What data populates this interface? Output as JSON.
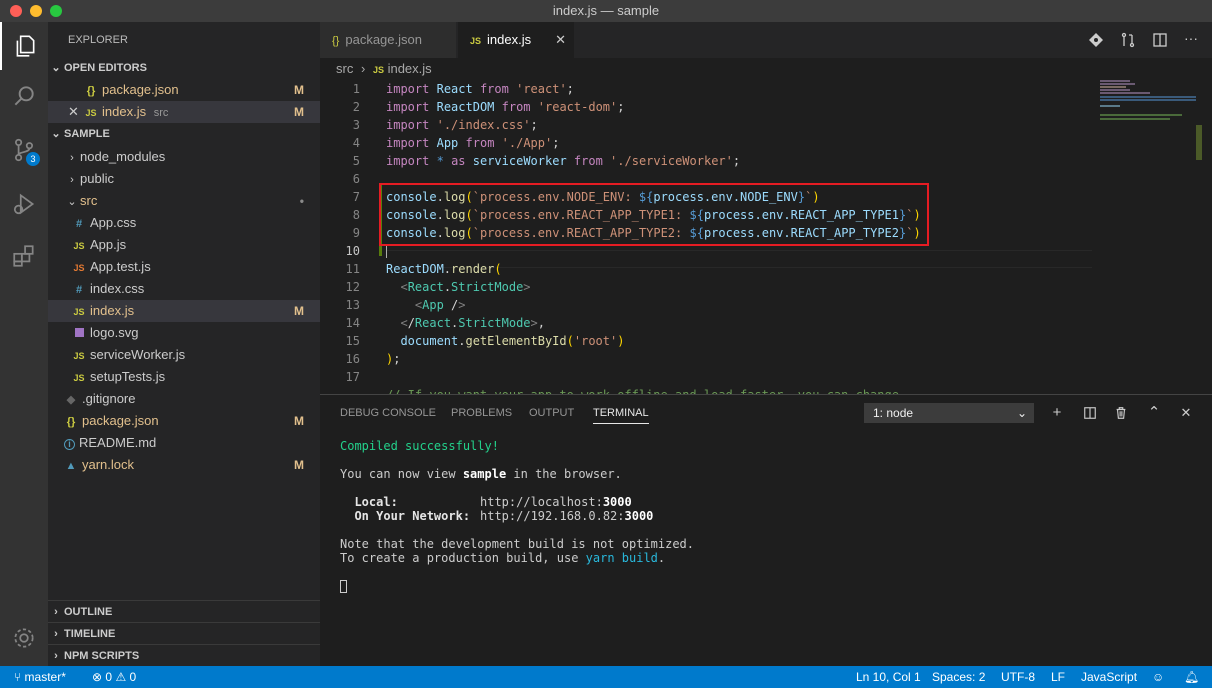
{
  "window": {
    "title": "index.js — sample"
  },
  "activity_bar": {
    "scm_badge": "3"
  },
  "explorer": {
    "title": "EXPLORER",
    "open_editors": {
      "header": "OPEN EDITORS",
      "items": [
        {
          "icon": "{}",
          "name": "package.json",
          "path": "",
          "status": "M"
        },
        {
          "icon": "JS",
          "name": "index.js",
          "path": "src",
          "status": "M"
        }
      ]
    },
    "workspace": {
      "header": "SAMPLE",
      "items": [
        {
          "icon": "",
          "name": "node_modules",
          "status": ""
        },
        {
          "icon": "",
          "name": "public",
          "status": ""
        },
        {
          "icon": "",
          "name": "src",
          "status": "•"
        },
        {
          "icon": "#",
          "name": "App.css",
          "status": ""
        },
        {
          "icon": "JS",
          "name": "App.js",
          "status": ""
        },
        {
          "icon": "JS",
          "name": "App.test.js",
          "status": ""
        },
        {
          "icon": "#",
          "name": "index.css",
          "status": ""
        },
        {
          "icon": "JS",
          "name": "index.js",
          "status": "M"
        },
        {
          "icon": "",
          "name": "logo.svg",
          "status": ""
        },
        {
          "icon": "JS",
          "name": "serviceWorker.js",
          "status": ""
        },
        {
          "icon": "JS",
          "name": "setupTests.js",
          "status": ""
        },
        {
          "icon": "",
          "name": ".gitignore",
          "status": ""
        },
        {
          "icon": "{}",
          "name": "package.json",
          "status": "M"
        },
        {
          "icon": "i",
          "name": "README.md",
          "status": ""
        },
        {
          "icon": "",
          "name": "yarn.lock",
          "status": "M"
        }
      ]
    },
    "outline": "OUTLINE",
    "timeline": "TIMELINE",
    "npm_scripts": "NPM SCRIPTS"
  },
  "tabs": [
    {
      "icon": "{}",
      "label": "package.json"
    },
    {
      "icon": "JS",
      "label": "index.js"
    }
  ],
  "breadcrumb": {
    "folder": "src",
    "icon": "JS",
    "file": "index.js"
  },
  "editor": {
    "line_numbers": [
      "1",
      "2",
      "3",
      "4",
      "5",
      "6",
      "7",
      "8",
      "9",
      "10",
      "11",
      "12",
      "13",
      "14",
      "15",
      "16",
      "17"
    ],
    "lines": [
      "import React from 'react';",
      "import ReactDOM from 'react-dom';",
      "import './index.css';",
      "import App from './App';",
      "import * as serviceWorker from './serviceWorker';",
      "",
      "console.log(`process.env.NODE_ENV: ${process.env.NODE_ENV}`)",
      "console.log(`process.env.REACT_APP_TYPE1: ${process.env.REACT_APP_TYPE1}`)",
      "console.log(`process.env.REACT_APP_TYPE2: ${process.env.REACT_APP_TYPE2}`)",
      "",
      "ReactDOM.render(",
      "  <React.StrictMode>",
      "    <App />",
      "  </React.StrictMode>,",
      "  document.getElementById('root')",
      ");",
      "",
      "// If you want your app to work offline and load faster, you can change"
    ]
  },
  "panel": {
    "tabs": [
      "DEBUG CONSOLE",
      "PROBLEMS",
      "OUTPUT",
      "TERMINAL"
    ],
    "active_tab": "TERMINAL",
    "terminal_select": "1: node",
    "terminal": {
      "compiled": "Compiled successfully!",
      "view_pre": "You can now view ",
      "view_app": "sample",
      "view_post": " in the browser.",
      "local_label": "  Local:",
      "local_url_pre": "http://localhost:",
      "local_port": "3000",
      "network_label": "  On Your Network:",
      "network_url_pre": "http://192.168.0.82:",
      "network_port": "3000",
      "note1": "Note that the development build is not optimized.",
      "note2_pre": "To create a production build, use ",
      "note2_cmd": "yarn build",
      "note2_post": "."
    }
  },
  "status_bar": {
    "branch": "master*",
    "errors": "0",
    "warnings": "0",
    "position": "Ln 10, Col 1",
    "spaces": "Spaces: 2",
    "encoding": "UTF-8",
    "eol": "LF",
    "language": "JavaScript"
  },
  "colors": {
    "accent": "#007acc",
    "highlight_box": "#e51c23",
    "modified": "#e2c08d"
  }
}
